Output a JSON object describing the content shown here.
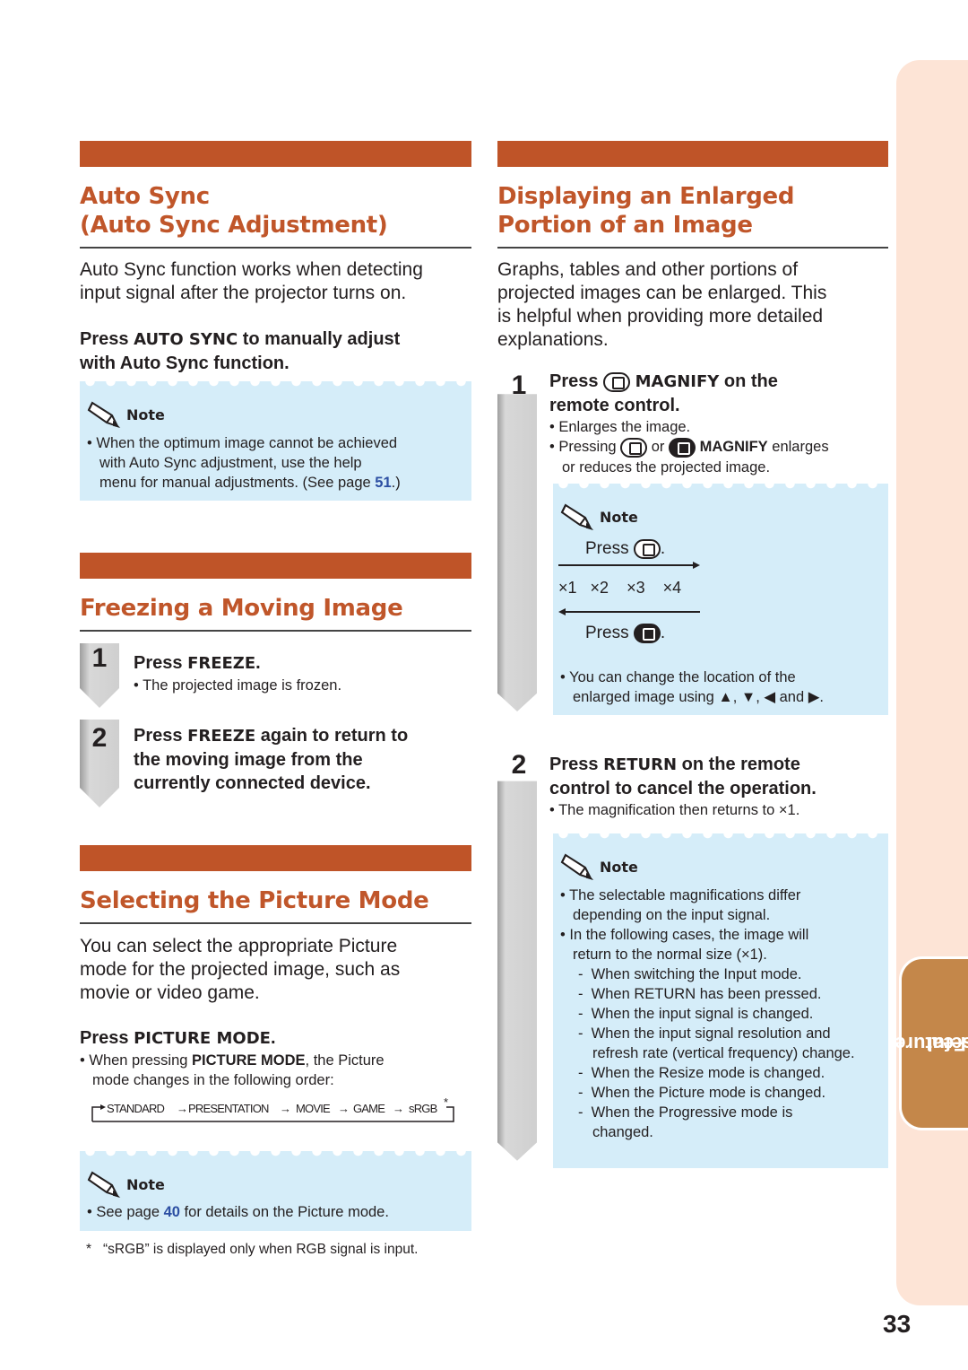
{
  "page_number": "33",
  "side_tab": {
    "line1": "Useful",
    "line2": "Features"
  },
  "colors": {
    "accent": "#bf5428",
    "title": "#c0562a",
    "note_bg": "#d5edf9",
    "link": "#2c4fa3",
    "side_strip": "#fde4d6",
    "side_tab": "#c4874a"
  },
  "auto_sync": {
    "title_line1": "Auto Sync",
    "title_line2": "(Auto Sync Adjustment)",
    "intro_line1": "Auto Sync function works when detecting",
    "intro_line2": "input signal after the projector turns on.",
    "instr_pre": "Press ",
    "instr_key": "AUTO SYNC",
    "instr_post1": " to manually adjust",
    "instr_line2": "with Auto Sync function.",
    "note_label": "Note",
    "note_line1": "When the optimum image cannot be achieved",
    "note_line2": "with Auto Sync adjustment, use the help",
    "note_line3": "menu for manual adjustments. (See page ",
    "note_page": "51",
    "note_end": ".)"
  },
  "freeze": {
    "title": "Freezing a Moving Image",
    "steps": [
      {
        "num": "1",
        "pre": "Press ",
        "key": "FREEZE",
        "post": ".",
        "sub": "The projected image is frozen."
      },
      {
        "num": "2",
        "pre": "Press ",
        "key": "FREEZE",
        "post": " again to return to",
        "line2": "the moving image from the",
        "line3": "currently connected device."
      }
    ]
  },
  "picture_mode": {
    "title": "Selecting the Picture Mode",
    "intro_line1": "You can select the appropriate Picture",
    "intro_line2": "mode for the projected image, such as",
    "intro_line3": "movie or video game.",
    "instr_pre": "Press ",
    "instr_key": "PICTURE MODE",
    "instr_post": ".",
    "bullet_pre": "When pressing ",
    "bullet_key": "PICTURE MODE",
    "bullet_post": ", the Picture",
    "bullet_line2": "mode changes in the following order:",
    "sequence": [
      "STANDARD",
      "PRESENTATION",
      "MOVIE",
      "GAME",
      "sRGB"
    ],
    "sequence_mark": "*",
    "note_label": "Note",
    "note_pre": "See page ",
    "note_page": "40",
    "note_post": " for details on the Picture mode.",
    "footnote_mark": "*",
    "footnote": "“sRGB” is displayed only when RGB signal is input."
  },
  "magnify": {
    "title_line1": "Displaying an Enlarged",
    "title_line2": "Portion of an Image",
    "intro_line1": "Graphs, tables and other portions of",
    "intro_line2": "projected images can be enlarged. This",
    "intro_line3": "is helpful when providing more detailed",
    "intro_line4": "explanations.",
    "step1": {
      "num": "1",
      "pre": "Press ",
      "key": "MAGNIFY",
      "post": " on the",
      "line2": "remote control.",
      "bullet1": "Enlarges the image.",
      "bullet2_pre": "Pressing ",
      "bullet2_or": " or ",
      "bullet2_key": "MAGNIFY",
      "bullet2_post": " enlarges",
      "bullet2_line2": "or reduces the projected image."
    },
    "note1": {
      "label": "Note",
      "press_label": "Press",
      "magnifications": [
        "×1",
        "×2",
        "×3",
        "×4"
      ],
      "bullet_line1": "You can change the location of the",
      "bullet_line2": "enlarged image using ▲, ▼, ◀ and ▶."
    },
    "step2": {
      "num": "2",
      "pre": "Press ",
      "key": "RETURN",
      "post": " on the remote",
      "line2": "control to cancel the operation.",
      "sub": "The magnification then returns to ×1."
    },
    "note2": {
      "label": "Note",
      "bullet1_line1": "The selectable magnifications differ",
      "bullet1_line2": "depending on the input signal.",
      "bullet2_line1": "In the following cases, the image will",
      "bullet2_line2": "return to the normal size (×1).",
      "dashes": [
        "When switching the Input mode.",
        "When RETURN has been pressed.",
        "When the input signal is changed.",
        "When the input signal resolution and refresh rate (vertical frequency) change.",
        "When the Resize mode is changed.",
        "When the Picture mode is changed.",
        "When the Progressive mode is changed."
      ]
    }
  }
}
